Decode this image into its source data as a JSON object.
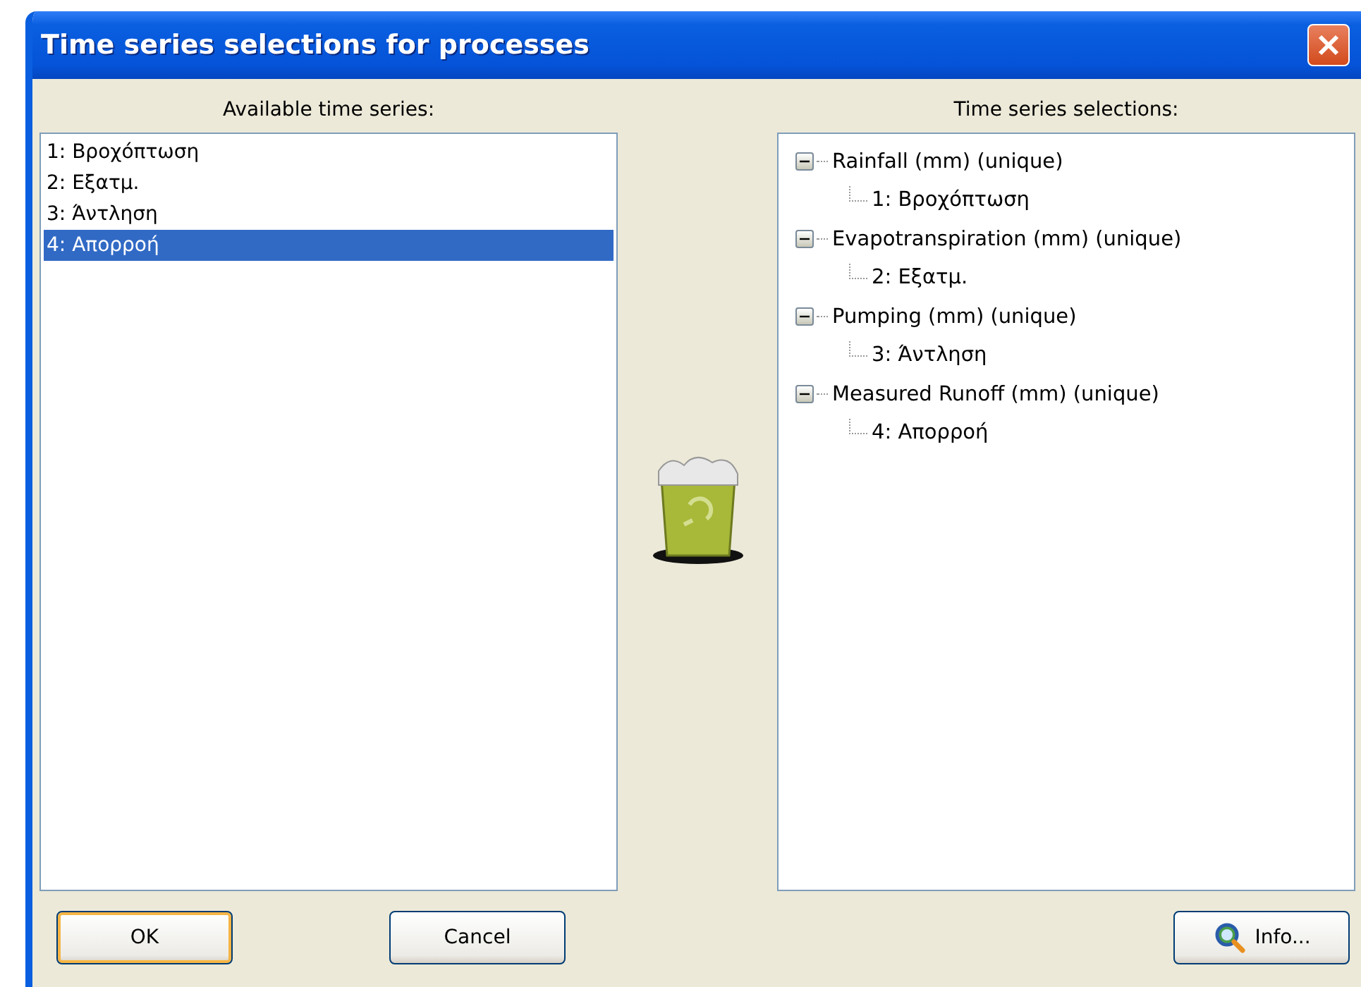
{
  "window": {
    "title": "Time series selections for processes"
  },
  "available": {
    "label": "Available time series:",
    "items": [
      {
        "label": "1: Βροχόπτωση",
        "selected": false
      },
      {
        "label": "2: Εξατμ.",
        "selected": false
      },
      {
        "label": "3: Άντληση",
        "selected": false
      },
      {
        "label": "4: Απορροή",
        "selected": true
      }
    ]
  },
  "selections": {
    "label": "Time series selections:",
    "tree": [
      {
        "label": "Rainfall (mm) (unique)",
        "expanded": true,
        "children": [
          {
            "label": "1: Βροχόπτωση"
          }
        ]
      },
      {
        "label": "Evapotranspiration (mm) (unique)",
        "expanded": true,
        "children": [
          {
            "label": "2: Εξατμ."
          }
        ]
      },
      {
        "label": "Pumping (mm) (unique)",
        "expanded": true,
        "children": [
          {
            "label": "3: Άντληση"
          }
        ]
      },
      {
        "label": "Measured Runoff (mm) (unique)",
        "expanded": true,
        "children": [
          {
            "label": "4: Απορροή"
          }
        ]
      }
    ]
  },
  "buttons": [
    {
      "label": "OK",
      "focused": true
    },
    {
      "label": "Cancel",
      "focused": false
    },
    {
      "label": "Info...",
      "focused": false,
      "kind": "icon"
    }
  ]
}
